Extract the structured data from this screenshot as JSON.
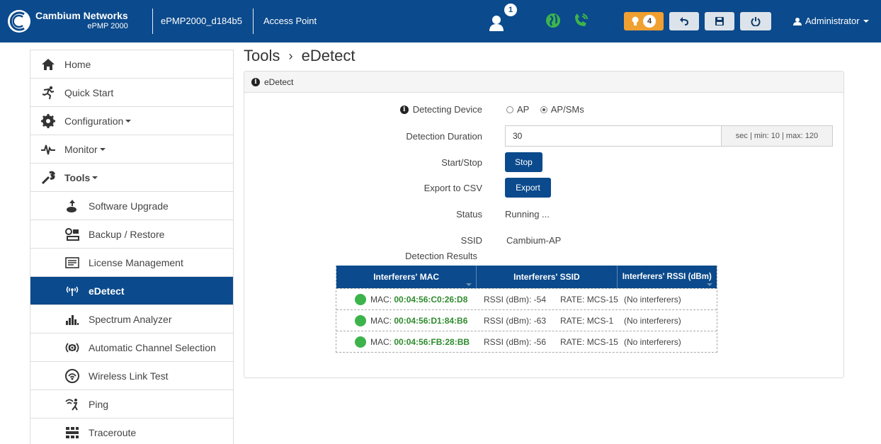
{
  "topbar": {
    "brand_name": "Cambium Networks",
    "brand_model": "ePMP 2000",
    "device_name": "ePMP2000_d184b5",
    "mode": "Access Point",
    "notification_count": "1",
    "alert_count": "4",
    "user": "Administrator",
    "icons": [
      "user-notification-icon",
      "globe-icon",
      "phone-icon",
      "lightbulb-icon",
      "undo-icon",
      "save-icon",
      "power-icon",
      "user-icon"
    ],
    "colors": {
      "bar": "#0b4a8c",
      "green": "#3cb44b",
      "alert": "#f0a030"
    }
  },
  "sidebar": {
    "items": [
      {
        "label": "Home",
        "icon": "home-icon"
      },
      {
        "label": "Quick Start",
        "icon": "run-icon"
      },
      {
        "label": "Configuration",
        "icon": "gear-icon"
      },
      {
        "label": "Monitor",
        "icon": "pulse-icon"
      },
      {
        "label": "Tools",
        "icon": "wrench-icon"
      },
      {
        "label": "Software Upgrade",
        "icon": "upgrade-icon"
      },
      {
        "label": "Backup / Restore",
        "icon": "backup-icon"
      },
      {
        "label": "License Management",
        "icon": "license-icon"
      },
      {
        "label": "eDetect",
        "icon": "edetect-icon"
      },
      {
        "label": "Spectrum Analyzer",
        "icon": "bar-chart-icon"
      },
      {
        "label": "Automatic Channel Selection",
        "icon": "channel-icon"
      },
      {
        "label": "Wireless Link Test",
        "icon": "link-test-icon"
      },
      {
        "label": "Ping",
        "icon": "ping-icon"
      },
      {
        "label": "Traceroute",
        "icon": "traceroute-icon"
      }
    ]
  },
  "page": {
    "title": "Tools",
    "subtitle": "eDetect",
    "panel_title": "eDetect"
  },
  "form": {
    "detecting_device_label": "Detecting Device",
    "option_ap": "AP",
    "option_apsms": "AP/SMs",
    "selected": "AP/SMs",
    "duration_label": "Detection Duration",
    "duration_value": "30",
    "duration_hint": "sec | min: 10 | max: 120",
    "startstop_label": "Start/Stop",
    "stop_button": "Stop",
    "export_label": "Export to CSV",
    "export_button": "Export",
    "status_label": "Status",
    "status_value": "Running ...",
    "ssid_label": "SSID",
    "ssid_value": "Cambium-AP",
    "results_label": "Detection Results"
  },
  "results": {
    "headers": [
      "Interferers' MAC",
      "Interferers' SSID",
      "Interferers' RSSI (dBm)"
    ],
    "rows": [
      {
        "mac_label": "MAC:",
        "mac": "00:04:56:C0:26:D8",
        "rssi": "RSSI (dBm): -54",
        "rate": "RATE: MCS-15",
        "note": "(No interferers)"
      },
      {
        "mac_label": "MAC:",
        "mac": "00:04:56:D1:84:B6",
        "rssi": "RSSI (dBm): -63",
        "rate": "RATE: MCS-1",
        "note": "(No interferers)"
      },
      {
        "mac_label": "MAC:",
        "mac": "00:04:56:FB:28:BB",
        "rssi": "RSSI (dBm): -56",
        "rate": "RATE: MCS-15",
        "note": "(No interferers)"
      }
    ]
  }
}
